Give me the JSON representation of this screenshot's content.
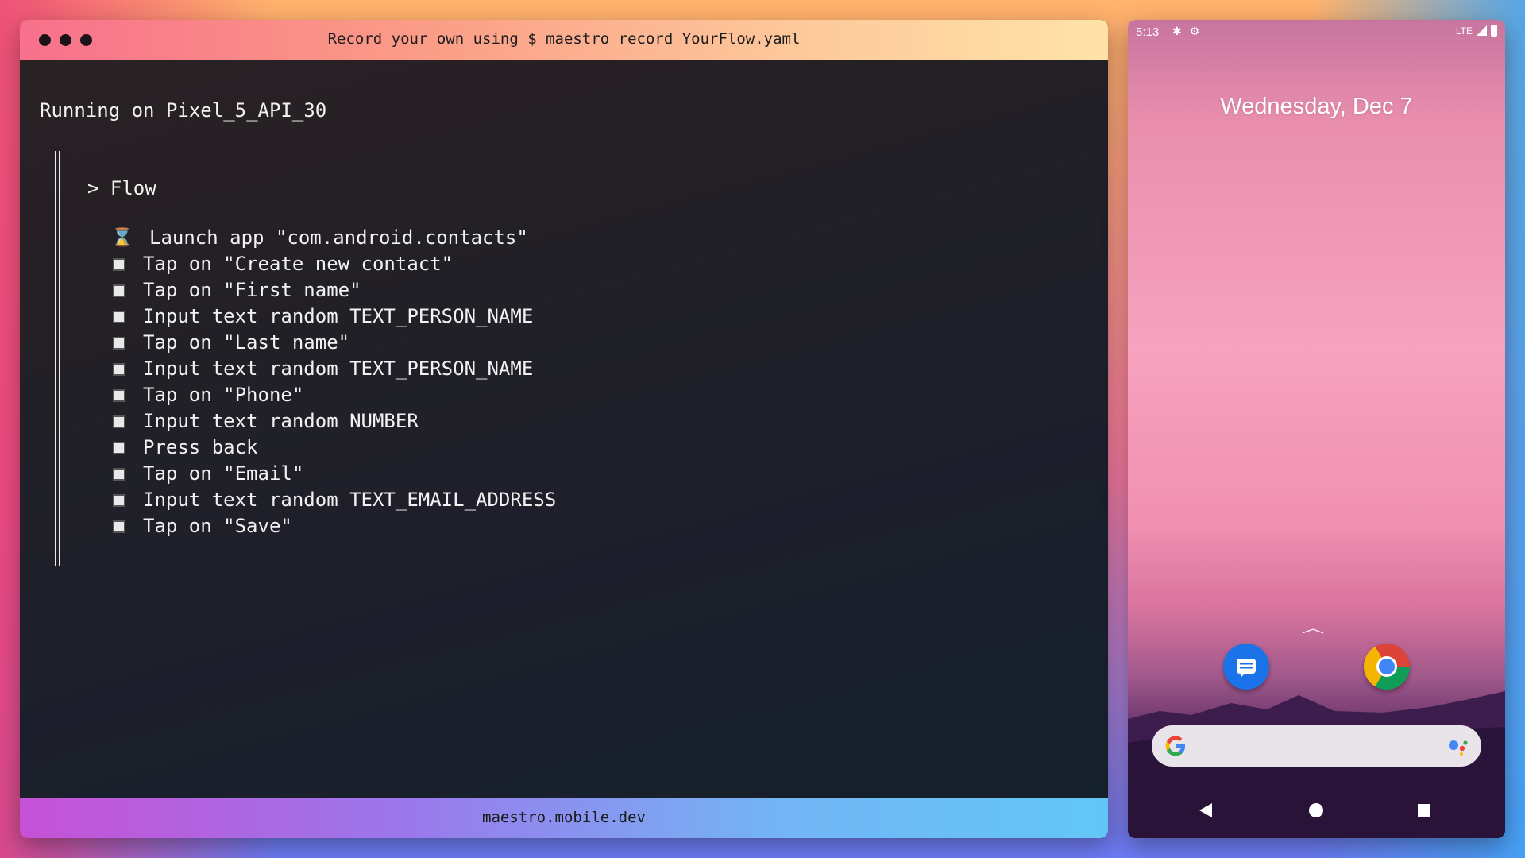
{
  "terminal": {
    "title": "Record your own using $ maestro record YourFlow.yaml",
    "running_line": "Running on Pixel_5_API_30",
    "flow_header": "> Flow",
    "steps": [
      {
        "label": "Launch app \"com.android.contacts\"",
        "status": "running"
      },
      {
        "label": "Tap on \"Create new contact\"",
        "status": "pending"
      },
      {
        "label": "Tap on \"First name\"",
        "status": "pending"
      },
      {
        "label": "Input text random TEXT_PERSON_NAME",
        "status": "pending"
      },
      {
        "label": "Tap on \"Last name\"",
        "status": "pending"
      },
      {
        "label": "Input text random TEXT_PERSON_NAME",
        "status": "pending"
      },
      {
        "label": "Tap on \"Phone\"",
        "status": "pending"
      },
      {
        "label": "Input text random NUMBER",
        "status": "pending"
      },
      {
        "label": "Press back",
        "status": "pending"
      },
      {
        "label": "Tap on \"Email\"",
        "status": "pending"
      },
      {
        "label": "Input text random TEXT_EMAIL_ADDRESS",
        "status": "pending"
      },
      {
        "label": "Tap on \"Save\"",
        "status": "pending"
      }
    ],
    "footer": "maestro.mobile.dev"
  },
  "phone": {
    "status_bar": {
      "time": "5:13",
      "network": "LTE"
    },
    "date": "Wednesday, Dec 7",
    "dock_apps": [
      {
        "name": "messages-icon"
      },
      {
        "name": "chrome-icon"
      }
    ]
  },
  "colors": {
    "terminal_bg": "#1f2029",
    "titlebar_start": "#f8708c",
    "titlebar_end": "#ffe3a8",
    "footer_start": "#c651d6",
    "footer_end": "#62c7f7"
  }
}
